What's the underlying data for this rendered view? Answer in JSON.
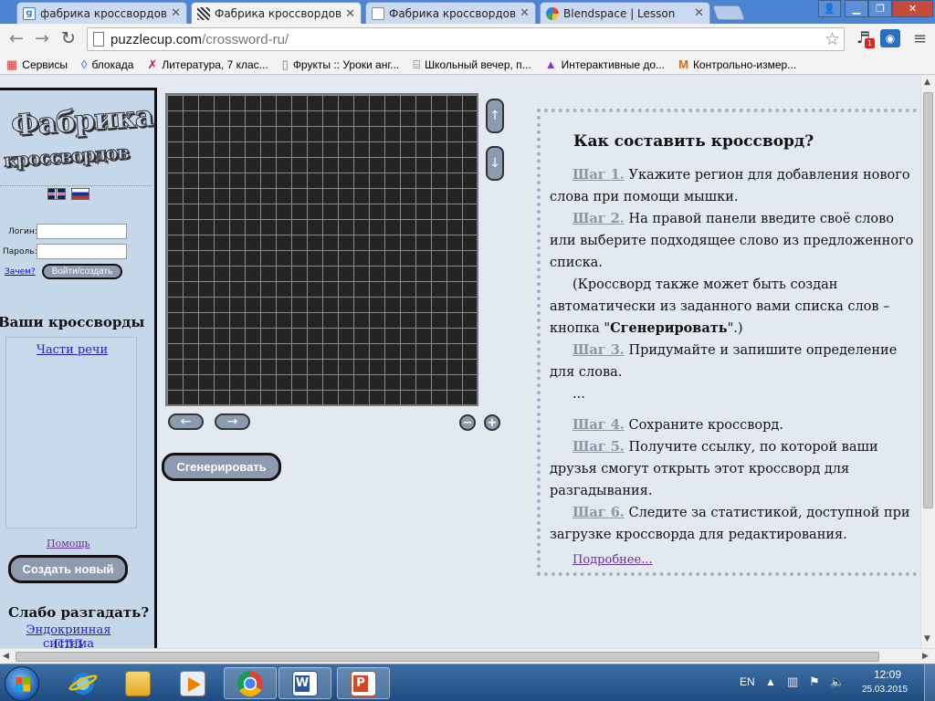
{
  "browser": {
    "tabs": [
      {
        "title": "фабрика кроссвордов - Г",
        "active": false,
        "favicon": "google-g-icon",
        "color": "#3b78e7"
      },
      {
        "title": "Фабрика кроссвордов",
        "active": true,
        "favicon": "crossword-grid-icon",
        "color": "#333333"
      },
      {
        "title": "Фабрика кроссвордов",
        "active": false,
        "favicon": "page-icon",
        "color": "#ffffff"
      },
      {
        "title": "Blendspace | Lesson",
        "active": false,
        "favicon": "blendspace-icon",
        "color": "#e64a19"
      }
    ],
    "window_buttons": {
      "user": "👤",
      "minimize": "▁",
      "maximize": "❐",
      "close": "✕"
    },
    "url_host": "puzzlecup.com",
    "url_path": "/crossword-ru/",
    "bookmarks": [
      {
        "label": "Сервисы",
        "icon": "apps-grid-icon"
      },
      {
        "label": "блокада",
        "icon": "ring-icon"
      },
      {
        "label": "Литература, 7 клас...",
        "icon": "x-mark-icon"
      },
      {
        "label": "Фрукты :: Уроки анг...",
        "icon": "page-icon"
      },
      {
        "label": "Школьный вечер, п...",
        "icon": "easel-icon"
      },
      {
        "label": "Интерактивные до...",
        "icon": "triangle-icon"
      },
      {
        "label": "Контрольно-измер...",
        "icon": "m-logo-icon"
      }
    ]
  },
  "sidebar": {
    "logo_line1": "Фабрика",
    "logo_line2": "кроссвордов",
    "login_label": "Логин:",
    "password_label": "Пароль:",
    "why_link": "Зачем?",
    "login_button": "Войти/создать",
    "my_crosswords_heading": "Ваши кроссворды",
    "my_crosswords": [
      "Части речи"
    ],
    "help_link": "Помощь",
    "create_button": "Создать новый",
    "weak_heading": "Слабо разгадать?",
    "weak_links": [
      "Эндокринная система",
      "ПДД"
    ]
  },
  "editor": {
    "up": "↑",
    "down": "↓",
    "left": "←",
    "right": "→",
    "zoom_out": "−",
    "zoom_in": "+",
    "generate_button": "Сгенерировать"
  },
  "instructions": {
    "title": "Как составить кроссворд?",
    "step1_label": "Шаг 1.",
    "step1_text": " Укажите регион для добавления нового слова при помощи мышки.",
    "step2_label": "Шаг 2.",
    "step2_text": " На правой панели введите своё слово или выберите подходящее слово из предложенного списка.",
    "note_before": "(Кроссворд также может быть создан автоматически из заданного вами списка слов – кнопка \"",
    "note_bold": "Сгенерировать",
    "note_after": "\".)",
    "step3_label": "Шаг 3.",
    "step3_text": " Придумайте и запишите определение для слова.",
    "ellipsis": "...",
    "step4_label": "Шаг 4.",
    "step4_text": " Сохраните кроссворд.",
    "step5_label": "Шаг 5.",
    "step5_text": " Получите ссылку, по которой ваши друзья смогут открыть этот кроссворд для разгадывания.",
    "step6_label": "Шаг 6.",
    "step6_text": " Следите за статистикой, доступной при загрузке кроссворда для редактирования.",
    "more_link": "Подробнее..."
  },
  "taskbar": {
    "apps": [
      "internet-explorer-icon",
      "file-explorer-icon",
      "media-player-icon",
      "chrome-icon",
      "word-icon",
      "powerpoint-icon"
    ],
    "language": "EN",
    "time": "12:09",
    "date": "25.03.2015"
  }
}
